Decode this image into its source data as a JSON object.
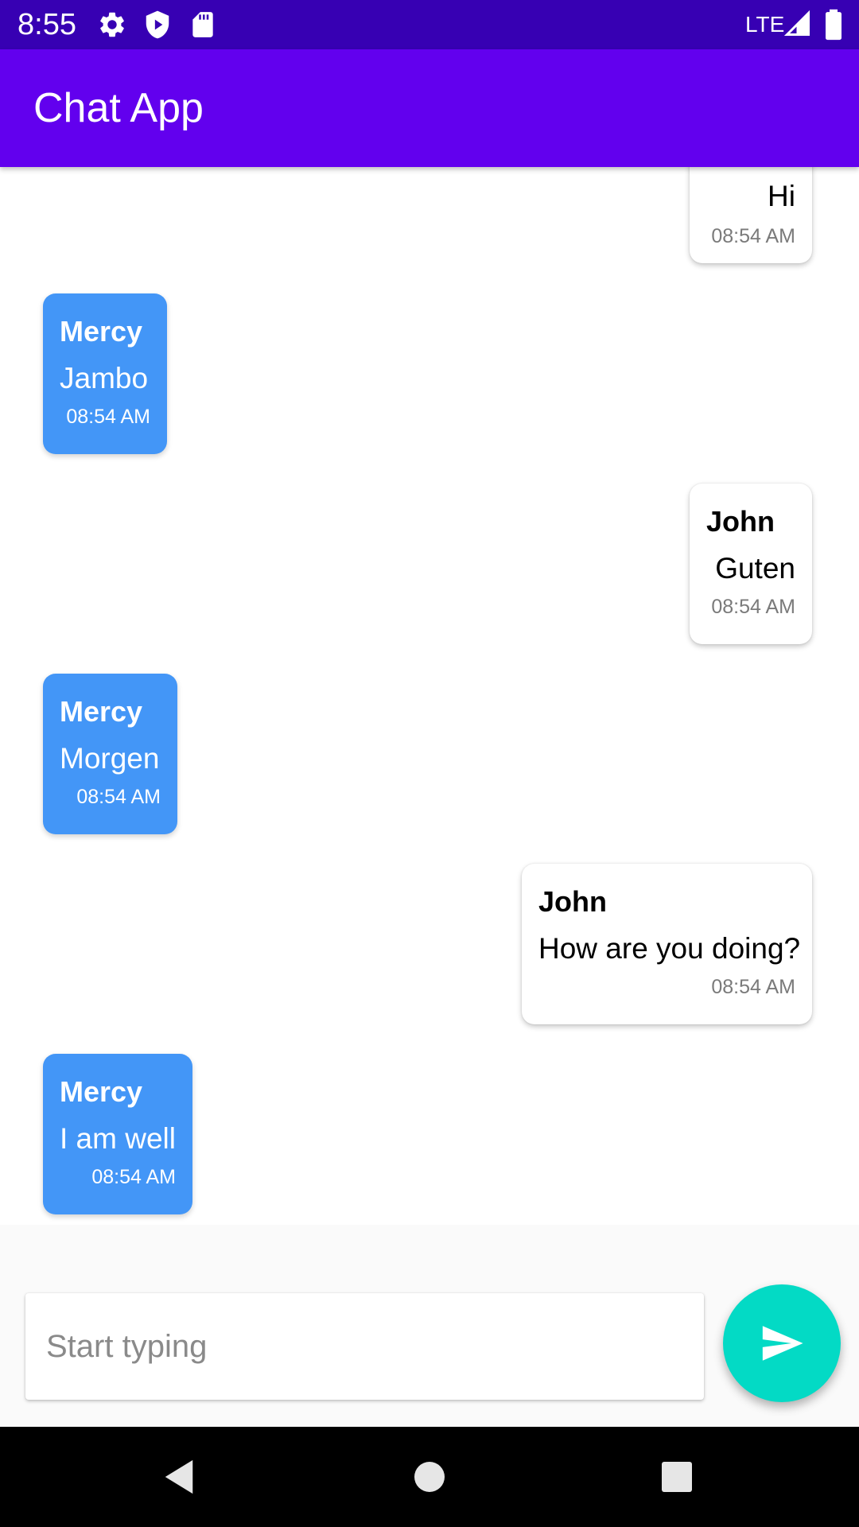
{
  "status_bar": {
    "time": "8:55",
    "network": "LTE",
    "icons": [
      "settings-icon",
      "shield-play-icon",
      "sd-card-icon",
      "signal-icon",
      "battery-icon"
    ]
  },
  "app_bar": {
    "title": "Chat App",
    "color": "#6200ee"
  },
  "messages": [
    {
      "direction": "outgoing",
      "sender": "",
      "text": "Hi",
      "time": "08:54 AM"
    },
    {
      "direction": "incoming",
      "sender": "Mercy",
      "text": "Jambo",
      "time": "08:54 AM"
    },
    {
      "direction": "outgoing",
      "sender": "John",
      "text": "Guten",
      "time": "08:54 AM"
    },
    {
      "direction": "incoming",
      "sender": "Mercy",
      "text": "Morgen",
      "time": "08:54 AM"
    },
    {
      "direction": "outgoing",
      "sender": "John",
      "text": "How are you doing?",
      "time": "08:54 AM"
    },
    {
      "direction": "incoming",
      "sender": "Mercy",
      "text": "I am well",
      "time": "08:54 AM"
    }
  ],
  "composer": {
    "placeholder": "Start typing",
    "value": "",
    "send_icon": "send-icon",
    "send_color": "#03dac5"
  },
  "nav_bar": {
    "icons": [
      "back-icon",
      "home-icon",
      "recents-icon"
    ]
  },
  "colors": {
    "status_bar": "#3700b3",
    "incoming_bubble": "#4396f7",
    "outgoing_bubble": "#ffffff"
  }
}
